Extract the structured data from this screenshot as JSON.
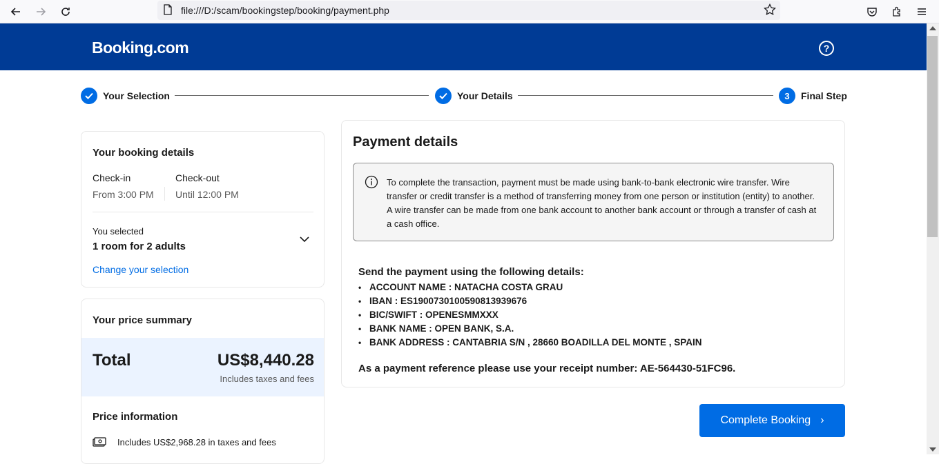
{
  "browser": {
    "url": "file:///D:/scam/bookingstep/booking/payment.php"
  },
  "header": {
    "logo": "Booking.com",
    "help_label": "?"
  },
  "progress": {
    "steps": [
      {
        "label": "Your Selection",
        "state": "done"
      },
      {
        "label": "Your Details",
        "state": "done"
      },
      {
        "label": "Final Step",
        "number": "3",
        "state": "current"
      }
    ]
  },
  "booking_details": {
    "title": "Your booking details",
    "checkin_label": "Check-in",
    "checkin_value": "From 3:00 PM",
    "checkout_label": "Check-out",
    "checkout_value": "Until 12:00 PM",
    "selected_label": "You selected",
    "selected_value": "1 room for 2 adults",
    "change_link": "Change your selection"
  },
  "price_summary": {
    "title": "Your price summary",
    "total_label": "Total",
    "total_value": "US$8,440.28",
    "total_note": "Includes taxes and fees",
    "info_title": "Price information",
    "tax_note": "Includes US$2,968.28 in taxes and fees"
  },
  "payment": {
    "title": "Payment details",
    "info_text": "To complete the transaction, payment must be made using bank-to-bank electronic wire transfer. Wire transfer or credit transfer is a method of transferring money from one person or institution (entity) to another. A wire transfer can be made from one bank account to another bank account or through a transfer of cash at a cash office.",
    "send_heading": "Send the payment using the following details:",
    "details": [
      "ACCOUNT NAME : NATACHA COSTA GRAU",
      "IBAN : ES1900730100590813939676",
      "BIC/SWIFT : OPENESMMXXX",
      "BANK NAME : OPEN BANK, S.A.",
      "BANK ADDRESS : CANTABRIA S/N , 28660 BOADILLA DEL MONTE , SPAIN"
    ],
    "reference": "As a payment reference please use your receipt number: AE-564430-51FC96."
  },
  "actions": {
    "complete_label": "Complete Booking",
    "complete_arrow": "›"
  },
  "colors": {
    "brand": "#003b95",
    "accent": "#006ce4",
    "total_band": "#ebf3ff"
  }
}
